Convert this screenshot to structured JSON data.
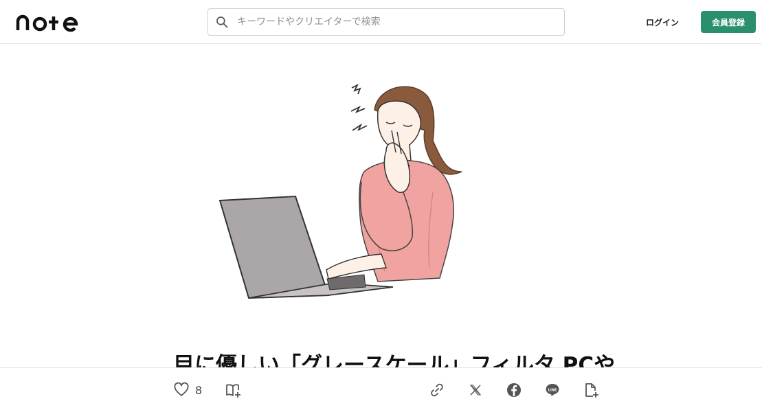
{
  "header": {
    "logo_text": "note",
    "search_placeholder": "キーワードやクリエイターで検索",
    "login_label": "ログイン",
    "signup_label": "会員登録",
    "accent_color": "#2a8f6d"
  },
  "article": {
    "title": "目に優しい「グレースケール」フィルタ PCや"
  },
  "actions": {
    "like_count": "8",
    "icons": [
      "heart-icon",
      "magazine-add-icon",
      "link-icon",
      "x-icon",
      "facebook-icon",
      "line-icon",
      "note-add-icon"
    ]
  }
}
